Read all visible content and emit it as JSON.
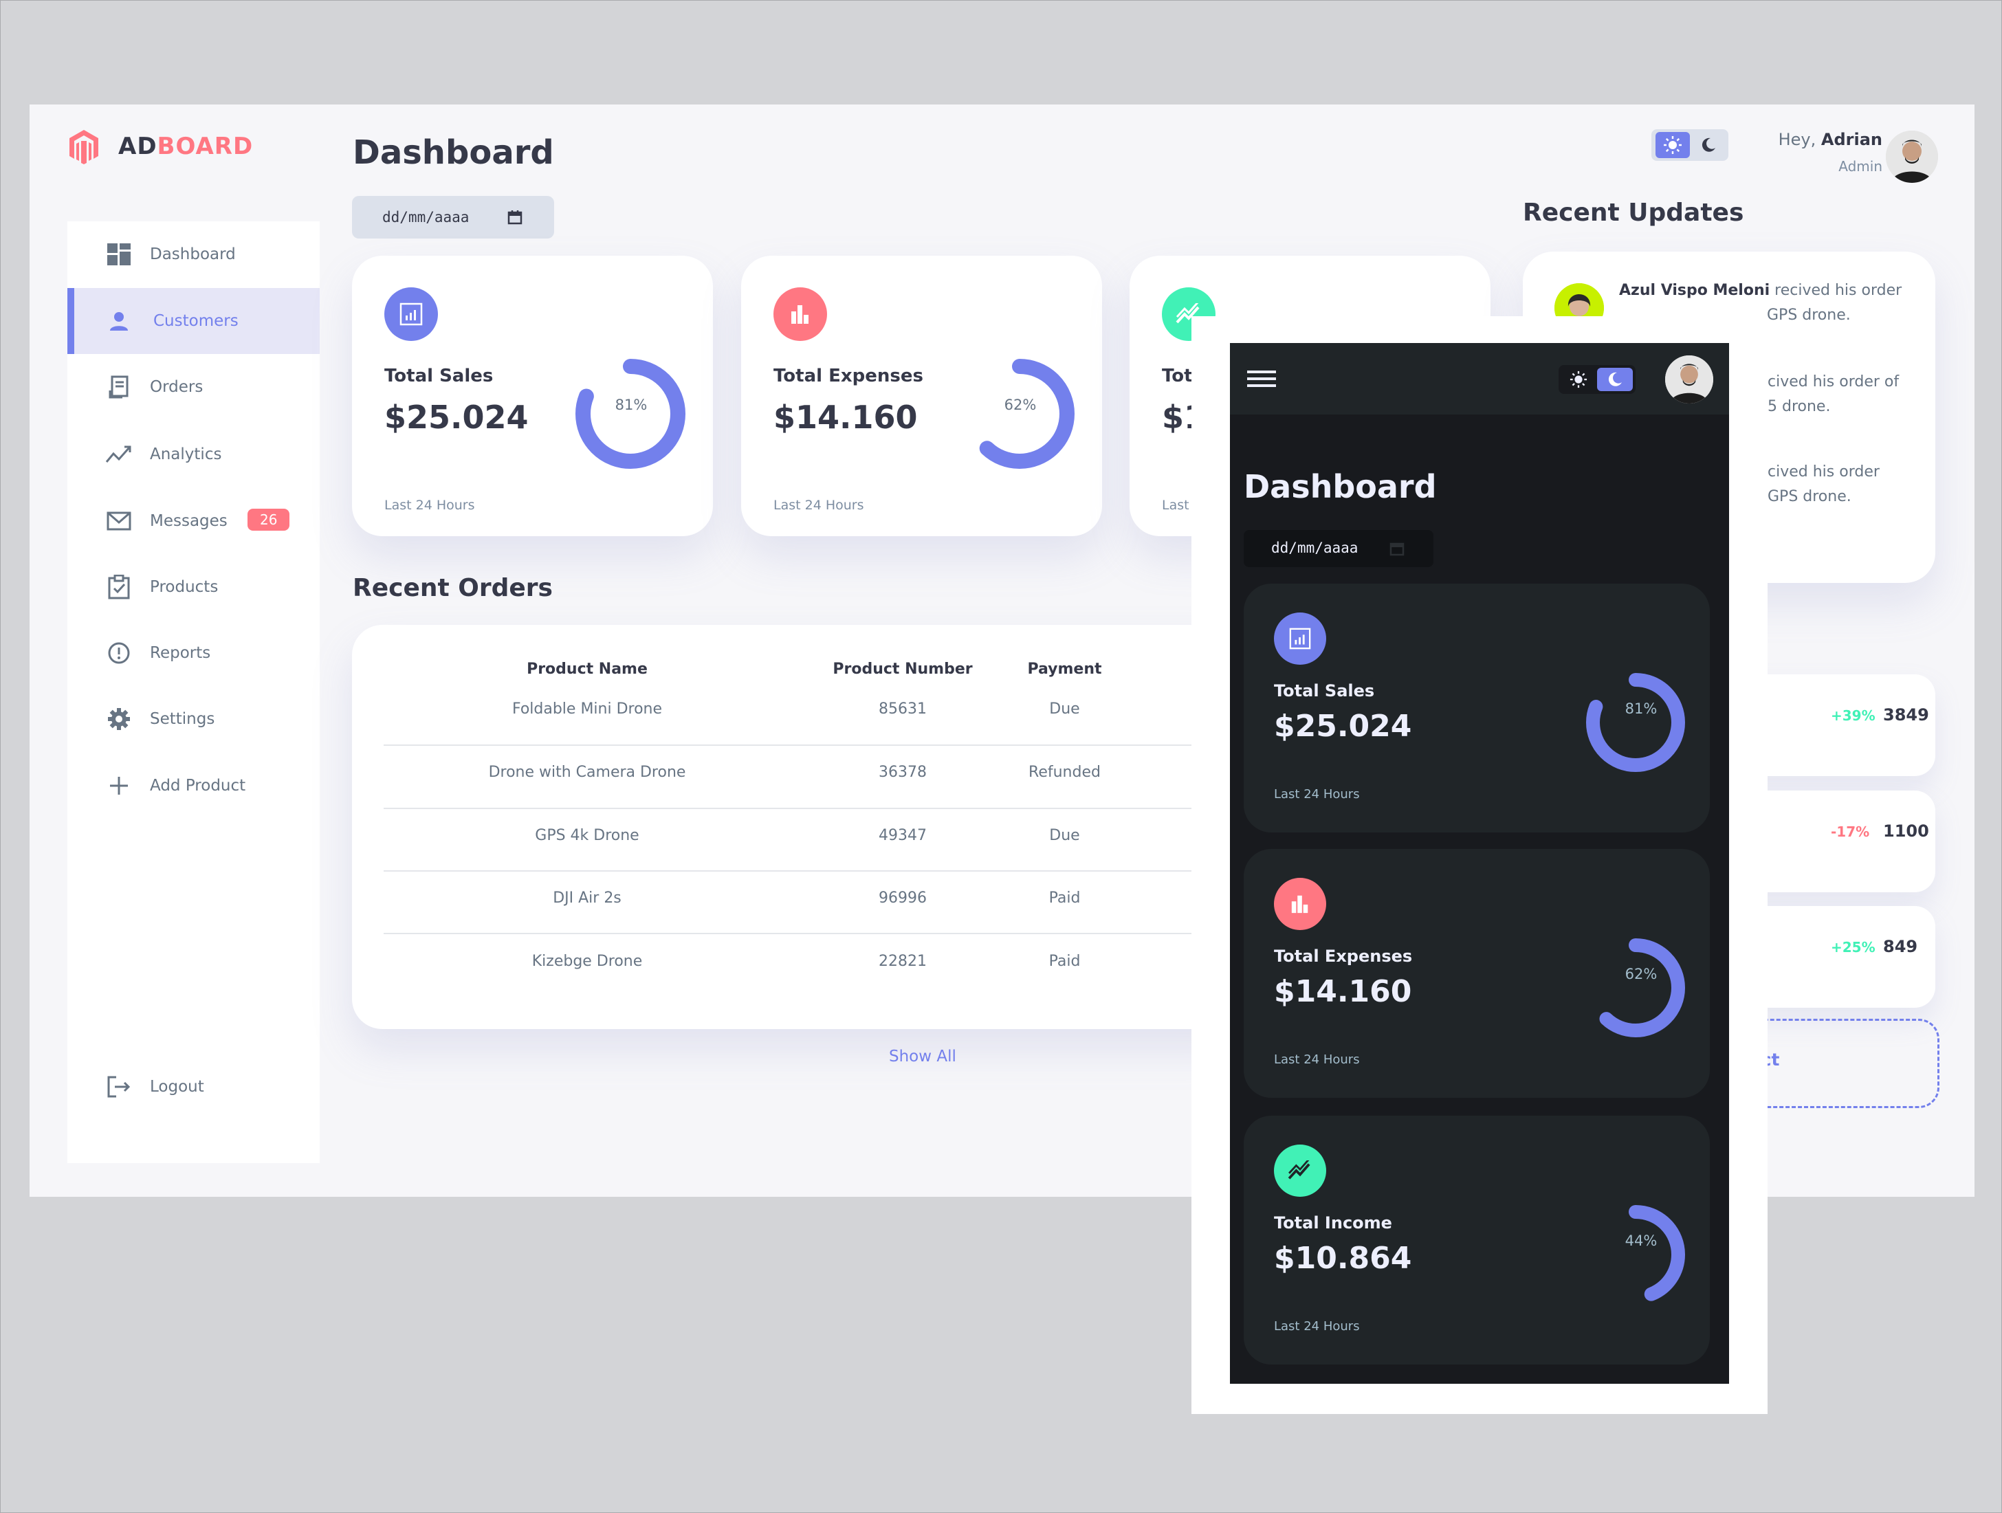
{
  "brand": {
    "part1": "AD",
    "part2": "BOARD"
  },
  "sidebar": {
    "items": [
      {
        "label": "Dashboard",
        "icon": "grid-icon"
      },
      {
        "label": "Customers",
        "icon": "person-icon"
      },
      {
        "label": "Orders",
        "icon": "receipt-icon"
      },
      {
        "label": "Analytics",
        "icon": "trend-icon"
      },
      {
        "label": "Messages",
        "icon": "mail-icon"
      },
      {
        "label": "Products",
        "icon": "clipboard-icon"
      },
      {
        "label": "Reports",
        "icon": "alert-icon"
      },
      {
        "label": "Settings",
        "icon": "gear-icon"
      },
      {
        "label": "Add Product",
        "icon": "plus-icon"
      }
    ],
    "messages_badge": "26",
    "logout_label": "Logout"
  },
  "header": {
    "title": "Dashboard",
    "date_placeholder": "dd/mm/aaaa",
    "greeting": "Hey,",
    "user_name": "Adrian",
    "user_role": "Admin"
  },
  "cards": [
    {
      "title": "Total Sales",
      "value": "$25.024",
      "percent_label": "81%",
      "percent": 0.81,
      "period": "Last 24 Hours",
      "color": "#7380ec"
    },
    {
      "title": "Total Expenses",
      "value": "$14.160",
      "percent_label": "62%",
      "percent": 0.62,
      "period": "Last 24 Hours",
      "color": "#ff7782"
    },
    {
      "title_partial": "Tot",
      "value_partial": "$1",
      "period_partial": "Last",
      "color": "#41f1b6"
    }
  ],
  "recent_orders": {
    "title": "Recent Orders",
    "headers": [
      "Product Name",
      "Product Number",
      "Payment"
    ],
    "rows": [
      [
        "Foldable Mini Drone",
        "85631",
        "Due"
      ],
      [
        "Drone with Camera Drone",
        "36378",
        "Refunded"
      ],
      [
        "GPS 4k Drone",
        "49347",
        "Due"
      ],
      [
        "DJI Air 2s",
        "96996",
        "Paid"
      ],
      [
        "Kizebge Drone",
        "22821",
        "Paid"
      ]
    ],
    "show_all": "Show All"
  },
  "recent_updates": {
    "title": "Recent Updates",
    "first_name": "Azul Vispo Meloni",
    "first_text": " recived his order",
    "lines": [
      "GPS drone.",
      "cived his order of",
      "5 drone.",
      "cived his order",
      "GPS drone."
    ]
  },
  "stats": [
    {
      "change": "+39%",
      "value": "3849",
      "color": "#41f1b6"
    },
    {
      "change": "-17%",
      "value": "1100",
      "color": "#ff7782"
    },
    {
      "change": "+25%",
      "value": "849",
      "color": "#41f1b6"
    }
  ],
  "add_product_partial": "duct",
  "mobile": {
    "title": "Dashboard",
    "date_placeholder": "dd/mm/aaaa",
    "cards": [
      {
        "title": "Total Sales",
        "value": "$25.024",
        "percent_label": "81%",
        "percent": 0.81,
        "period": "Last 24 Hours",
        "color": "#7380ec"
      },
      {
        "title": "Total Expenses",
        "value": "$14.160",
        "percent_label": "62%",
        "percent": 0.62,
        "period": "Last 24 Hours",
        "color": "#ff7782"
      },
      {
        "title": "Total Income",
        "value": "$10.864",
        "percent_label": "44%",
        "percent": 0.44,
        "period": "Last 24 Hours",
        "color": "#41f1b6"
      }
    ]
  },
  "colors": {
    "primary": "#7380ec",
    "danger": "#ff7782",
    "success": "#41f1b6",
    "dark": "#363949"
  }
}
